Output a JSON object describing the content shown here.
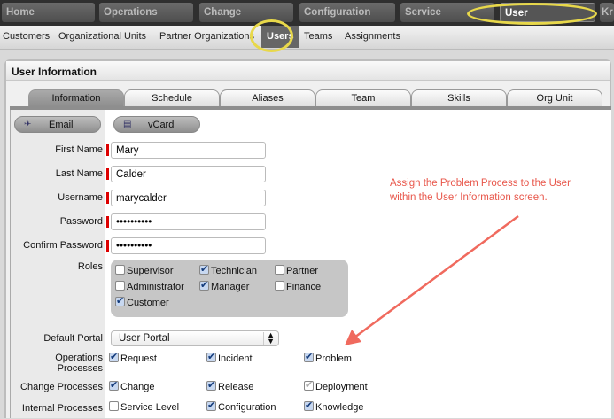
{
  "topnav": [
    "Home",
    "Operations",
    "Change",
    "Configuration",
    "Service",
    "User",
    "Kr"
  ],
  "subnav": [
    "Customers",
    "Organizational Units",
    "Partner Organizations",
    "Users",
    "Teams",
    "Assignments"
  ],
  "panel_title": "User Information",
  "tabs": [
    "Information",
    "Schedule",
    "Aliases",
    "Team",
    "Skills",
    "Org Unit"
  ],
  "buttons": {
    "email": "Email",
    "vcard": "vCard"
  },
  "fields": {
    "first_name": {
      "label": "First Name",
      "value": "Mary"
    },
    "last_name": {
      "label": "Last Name",
      "value": "Calder"
    },
    "username": {
      "label": "Username",
      "value": "marycalder"
    },
    "password": {
      "label": "Password",
      "value": "••••••••••"
    },
    "confirm_password": {
      "label": "Confirm Password",
      "value": "••••••••••"
    }
  },
  "roles": {
    "label": "Roles",
    "items": [
      {
        "label": "Supervisor",
        "checked": false
      },
      {
        "label": "Technician",
        "checked": true
      },
      {
        "label": "Partner",
        "checked": false
      },
      {
        "label": "Administrator",
        "checked": false
      },
      {
        "label": "Manager",
        "checked": true
      },
      {
        "label": "Finance",
        "checked": false
      },
      {
        "label": "Customer",
        "checked": true
      }
    ]
  },
  "default_portal": {
    "label": "Default Portal",
    "value": "User Portal"
  },
  "processes": {
    "operations": {
      "label": "Operations Processes",
      "items": [
        {
          "label": "Request",
          "checked": true
        },
        {
          "label": "Incident",
          "checked": true
        },
        {
          "label": "Problem",
          "checked": true
        }
      ]
    },
    "change": {
      "label": "Change Processes",
      "items": [
        {
          "label": "Change",
          "checked": true
        },
        {
          "label": "Release",
          "checked": true
        },
        {
          "label": "Deployment",
          "checked": true,
          "disabled": true
        }
      ]
    },
    "internal": {
      "label": "Internal Processes",
      "items": [
        {
          "label": "Service Level",
          "checked": false
        },
        {
          "label": "Configuration",
          "checked": true
        },
        {
          "label": "Knowledge",
          "checked": true
        }
      ]
    }
  },
  "annotation": {
    "line1": "Assign the Problem Process to the User",
    "line2": "within the User Information screen.",
    "color": "#e8564a"
  }
}
